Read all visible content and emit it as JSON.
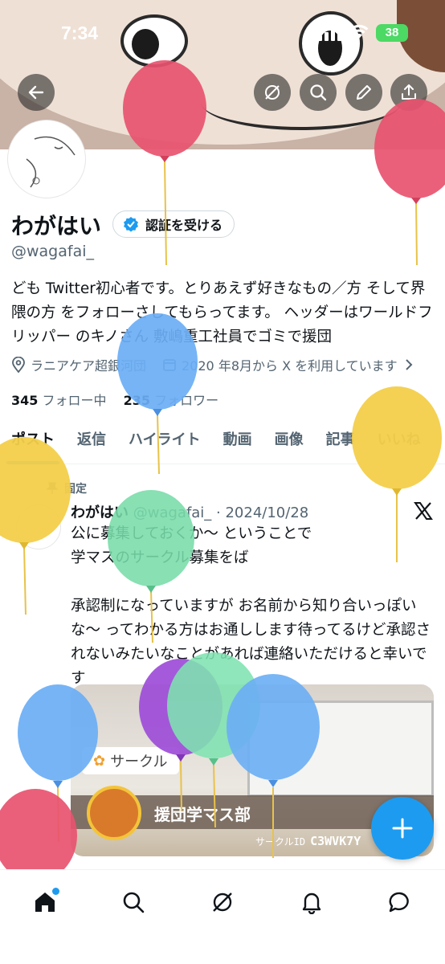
{
  "status_bar": {
    "time": "7:34",
    "battery": "38"
  },
  "header": {
    "back": "back",
    "actions": [
      "grok-icon",
      "search-icon",
      "edit-icon",
      "share-icon"
    ]
  },
  "profile": {
    "name": "わがはい",
    "verify_label": "認証を受ける",
    "handle": "@wagafai_",
    "bio": "ども Twitter初心者です。とりあえず好きなもの／方 そして界隈の方 をフォローさしてもらってます。 ヘッダーはワールドフリッパー のキノさん 敷嶋重工社員でゴミで援団",
    "location": "ラニアケア超銀河団",
    "joined": "2020 年8月から X を利用しています",
    "following_count": "345",
    "following_label": "フォロー中",
    "followers_count": "235",
    "followers_label": "フォロワー"
  },
  "tabs": [
    "ポスト",
    "返信",
    "ハイライト",
    "動画",
    "画像",
    "記事",
    "いいね"
  ],
  "active_tab": "ポスト",
  "post": {
    "pinned_label": "固定",
    "author": "わがはい",
    "handle_date": "@wagafai_ · 2024/10/28",
    "text": "公に募集しておくか〜 ということで\n学マスのサークル募集をば\n\n承認制になっていますが お名前から知り合いっぽいな〜 ってわかる方はお通しします待ってるけど承認されないみたいなことがあれば連絡いただけると幸いです",
    "card": {
      "tag": "サークル",
      "club_name": "援団学マス部",
      "id_label": "サークルID",
      "id_value": "C3WVK7Y"
    }
  },
  "nav": [
    "home-icon",
    "search-icon",
    "grok-icon",
    "notifications-icon",
    "messages-icon"
  ],
  "colors": {
    "accent": "#1d9bf0",
    "text": "#0f1419",
    "muted": "#536471"
  }
}
